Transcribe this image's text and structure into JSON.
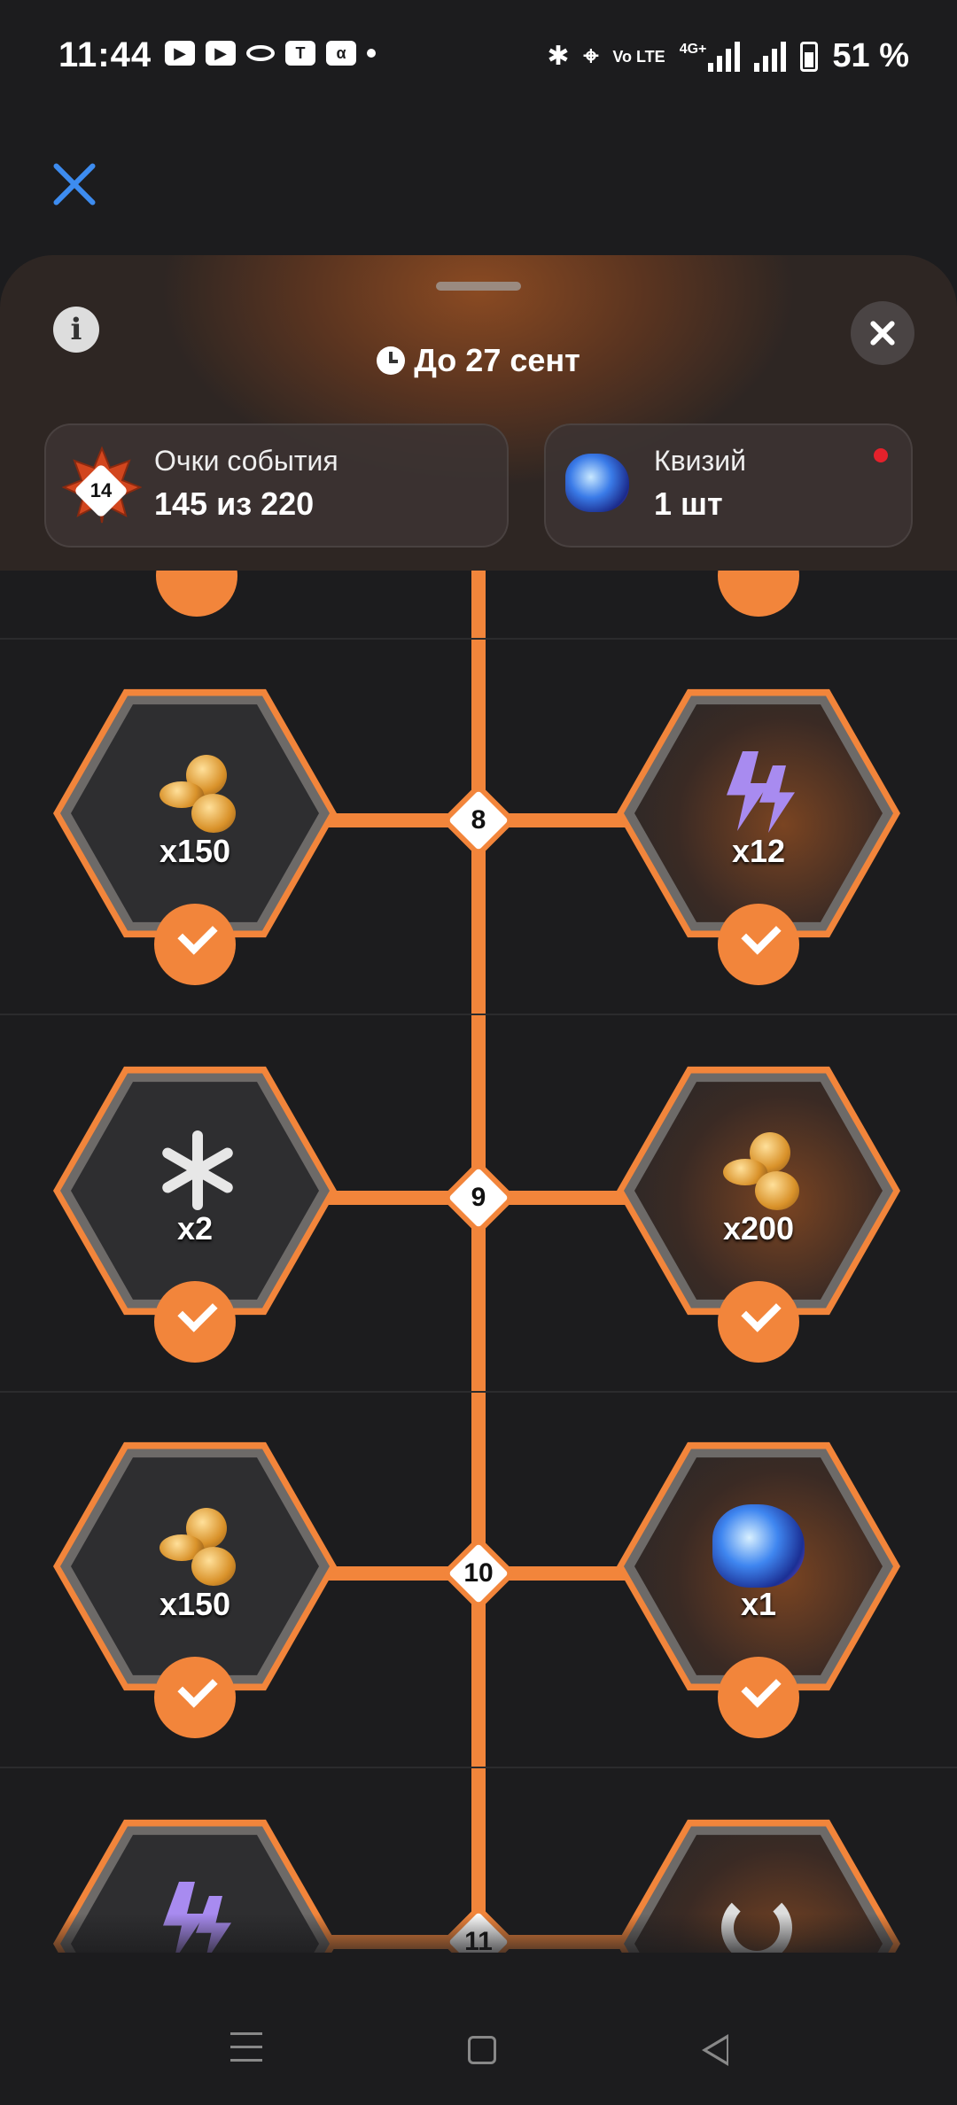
{
  "status_bar": {
    "time": "11:44",
    "battery_percent": "51 %",
    "network": "4G+",
    "volte": "Vo LTE",
    "app_icons": [
      "youtube-icon",
      "youtube-icon",
      "oval-app-icon",
      "t-app-icon",
      "alpha-app-icon"
    ]
  },
  "header": {
    "deadline": "До 27 сент",
    "event_points": {
      "title": "Очки события",
      "value": "145 из 220",
      "level": "14"
    },
    "quizy": {
      "title": "Квизий",
      "value": "1 шт"
    }
  },
  "track": {
    "levels": [
      {
        "level": "8",
        "left": {
          "reward": "coins",
          "amount": "x150",
          "claimed": true,
          "glow": false
        },
        "right": {
          "reward": "energy",
          "amount": "x12",
          "claimed": true,
          "glow": true
        }
      },
      {
        "level": "9",
        "left": {
          "reward": "freeze",
          "amount": "x2",
          "claimed": true,
          "glow": false
        },
        "right": {
          "reward": "coins",
          "amount": "x200",
          "claimed": true,
          "glow": true
        }
      },
      {
        "level": "10",
        "left": {
          "reward": "coins",
          "amount": "x150",
          "claimed": true,
          "glow": false
        },
        "right": {
          "reward": "gem",
          "amount": "x1",
          "claimed": true,
          "glow": true
        }
      },
      {
        "level": "11",
        "left": {
          "reward": "energy",
          "amount": "",
          "claimed": false,
          "glow": false
        },
        "right": {
          "reward": "refresh",
          "amount": "",
          "claimed": false,
          "glow": true
        }
      }
    ]
  },
  "colors": {
    "accent": "#f2853b",
    "background": "#1c1c1e",
    "close_blue": "#3d8cf0",
    "notification": "#e5212b"
  }
}
